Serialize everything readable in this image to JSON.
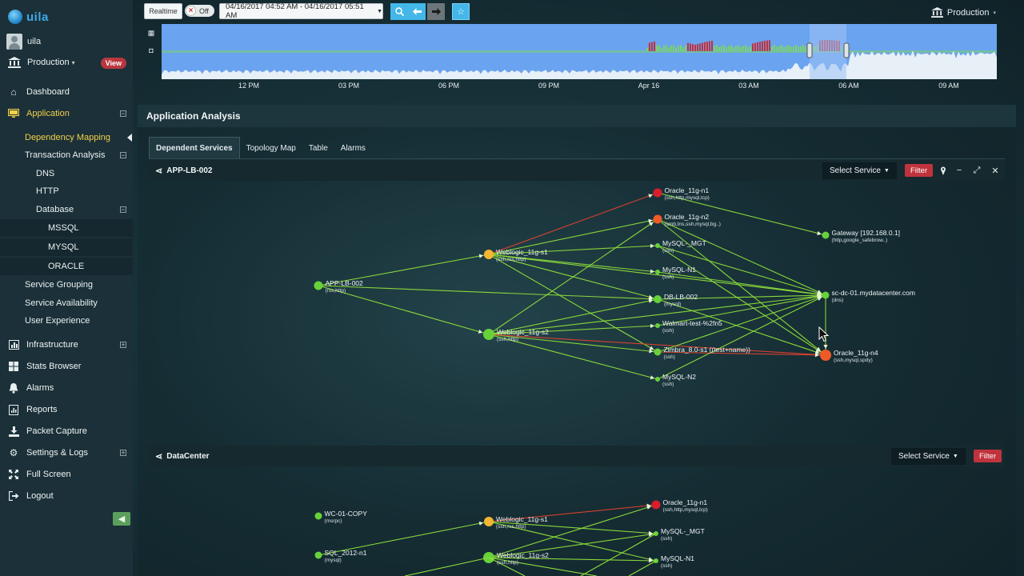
{
  "app": {
    "logo_text": "uila"
  },
  "user": {
    "name": "uila"
  },
  "environment": {
    "label": "Production",
    "view_badge": "View"
  },
  "sidebar": {
    "dashboard": "Dashboard",
    "application": "Application",
    "dependency_mapping": "Dependency Mapping",
    "transaction_analysis": "Transaction Analysis",
    "dns": "DNS",
    "http": "HTTP",
    "database": "Database",
    "mssql": "MSSQL",
    "mysql": "MYSQL",
    "oracle": "ORACLE",
    "service_grouping": "Service Grouping",
    "service_availability": "Service Availability",
    "user_experience": "User Experience",
    "infrastructure": "Infrastructure",
    "stats_browser": "Stats Browser",
    "alarms": "Alarms",
    "reports": "Reports",
    "packet_capture": "Packet Capture",
    "settings_logs": "Settings & Logs",
    "full_screen": "Full Screen",
    "logout": "Logout"
  },
  "topbar": {
    "realtime": "Realtime",
    "toggle": "Off",
    "date_range": "04/16/2017 04:52 AM - 04/16/2017 05:51 AM",
    "production": "Production"
  },
  "timeline": {
    "labels": [
      "12 PM",
      "03 PM",
      "06 PM",
      "09 PM",
      "Apr 16",
      "03 AM",
      "06 AM",
      "09 AM"
    ]
  },
  "panel": {
    "title": "Application Analysis",
    "tabs": [
      "Dependent Services",
      "Topology Map",
      "Table",
      "Alarms"
    ]
  },
  "graph1": {
    "title": "APP-LB-002",
    "select_service": "Select Service",
    "filter": "Filter",
    "nodes": {
      "app_lb": {
        "name": "APP-LB-002",
        "sub": "(rss,http)"
      },
      "wl1": {
        "name": "Weblogic_11g-s1",
        "sub": "(ssh,rss,http)"
      },
      "wl2": {
        "name": "Weblogic_11g-s2",
        "sub": "(ssh,http)"
      },
      "ora1": {
        "name": "Oracle_11g-n1",
        "sub": "(ssh,http,mysql,tcp)"
      },
      "ora2": {
        "name": "Oracle_11g-n2",
        "sub": "(smb,tns,ssh,mysql,bg..)"
      },
      "mgt": {
        "name": "MySQL-_MGT",
        "sub": "(ssh)"
      },
      "n1": {
        "name": "MySQL-N1",
        "sub": "(ssh)"
      },
      "dblb": {
        "name": "DB-LB-002",
        "sub": "(mysql)"
      },
      "walmart": {
        "name": "Walmart-test-%2fn5",
        "sub": "(ssh)"
      },
      "zimbra": {
        "name": "Zimbra_8.0-s1 ((test+name))",
        "sub": "(ssh)"
      },
      "n2": {
        "name": "MySQL-N2",
        "sub": "(ssh)"
      },
      "gateway": {
        "name": "Gateway [192.168.0.1]",
        "sub": "(http,google_safebrow..)"
      },
      "dc": {
        "name": "sc-dc-01.mydatacenter.com",
        "sub": "(dns)"
      },
      "ora4": {
        "name": "Oracle_11g-n4",
        "sub": "(ssh,mysql,spdy)"
      }
    }
  },
  "graph2": {
    "title": "DataCenter",
    "select_service": "Select Service",
    "filter": "Filter",
    "nodes": {
      "wc": {
        "name": "WC-01-COPY",
        "sub": "(msrpc)"
      },
      "sql": {
        "name": "SQL_2012-n1",
        "sub": "(mysql)"
      },
      "wl1": {
        "name": "Weblogic_11g-s1",
        "sub": "(ssh,rss,http)"
      },
      "wl2": {
        "name": "Weblogic_11g-s2",
        "sub": "(ssh,http)"
      },
      "ora1": {
        "name": "Oracle_11g-n1",
        "sub": "(ssh,http,mysql,tcp)"
      },
      "mgt": {
        "name": "MySQL-_MGT",
        "sub": "(ssh)"
      },
      "n1": {
        "name": "MySQL-N1",
        "sub": "(ssh)"
      }
    }
  },
  "colors": {
    "edge_green": "#8fe03a",
    "edge_red": "#e0412f",
    "node_green": "#67d13a",
    "node_yellow": "#f2b632",
    "node_orange": "#f05a28",
    "node_red": "#d81e2a",
    "accent_yellow": "#f1d04a"
  }
}
